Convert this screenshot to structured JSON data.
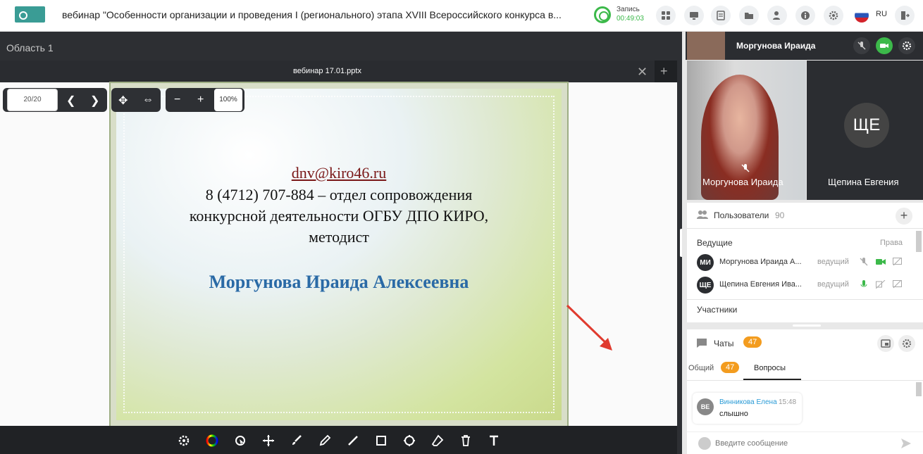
{
  "header": {
    "title": "вебинар \"Особенности организации и проведения I (регионального) этапа XVIII Всероссийского конкурса в...",
    "record_label": "Запись",
    "record_time": "00:49:03",
    "language": "RU",
    "icons": [
      "apps-icon",
      "screen-share-icon",
      "notes-icon",
      "folder-icon",
      "users-manage-icon",
      "info-icon",
      "settings-icon",
      "exit-icon"
    ]
  },
  "workspace": {
    "area_label": "Область 1",
    "doc_name": "вебинар 17.01.pptx",
    "page_indicator": "20/20",
    "zoom": "100%"
  },
  "slide": {
    "email": "dnv@kiro46.ru",
    "line1": "8 (4712) 707-884 – отдел сопровождения",
    "line2": "конкурсной деятельности ОГБУ ДПО КИРО,",
    "line3": "методист",
    "name": "Моргунова Ираида Алексеевна"
  },
  "video": {
    "presenter": "Моргунова Ираида",
    "tile1_name": "Моргунова Ираида",
    "tile2_name": "Щепина Евгения",
    "tile2_initials": "ЩЕ"
  },
  "users_panel": {
    "title": "Пользователи",
    "count": "90",
    "hosts_label": "Ведущие",
    "rights_label": "Права",
    "participants_label": "Участники",
    "hosts": [
      {
        "initials": "МИ",
        "name": "Моргунова Ираида А...",
        "role": "ведущий"
      },
      {
        "initials": "ЩЕ",
        "name": "Щепина Евгения Ива...",
        "role": "ведущий"
      }
    ]
  },
  "chats_panel": {
    "title": "Чаты",
    "count": "47",
    "tab_general": "Общий",
    "tab_general_count": "47",
    "tab_questions": "Вопросы",
    "message": {
      "initials": "ВЕ",
      "author": "Винникова Елена",
      "time": "15:48",
      "text": "слышно"
    },
    "input_placeholder": "Введите сообщение"
  },
  "colors": {
    "accent_green": "#3cb94a",
    "badge_orange": "#f39c1f",
    "dark": "#2b2d31"
  }
}
